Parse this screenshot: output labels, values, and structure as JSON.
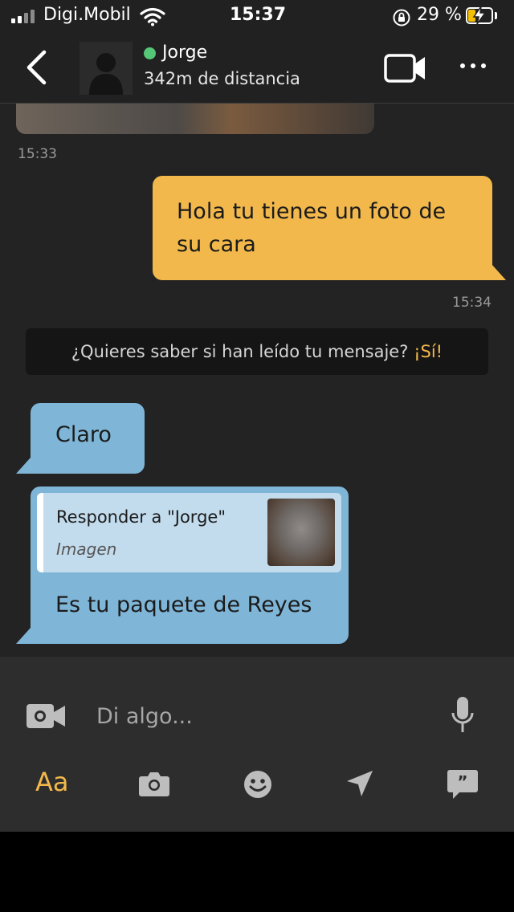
{
  "status_bar": {
    "carrier": "Digi.Mobil",
    "time": "15:37",
    "battery": "29 %",
    "colors": {
      "battery_fill": "#f5c000"
    }
  },
  "header": {
    "contact_name": "Jorge",
    "distance": "342m de distancia",
    "online_color": "#55c877",
    "icons": [
      "back-icon",
      "avatar-placeholder",
      "video-call-icon",
      "more-icon"
    ]
  },
  "chat": {
    "messages": [
      {
        "type": "image",
        "direction": "incoming",
        "timestamp": "15:33"
      },
      {
        "type": "text",
        "direction": "outgoing",
        "text": "Hola tu tienes un foto de su cara",
        "timestamp": "15:34"
      },
      {
        "type": "text",
        "direction": "incoming",
        "text": "Claro"
      },
      {
        "type": "reply",
        "direction": "incoming",
        "reply_title": "Responder a \"Jorge\"",
        "reply_subtitle": "Imagen",
        "text": "Es tu paquete de Reyes"
      }
    ],
    "read_receipt": {
      "prompt": "¿Quieres saber si han leído tu mensaje?",
      "action": "¡Sí!"
    },
    "colors": {
      "outgoing": "#f2b84b",
      "incoming": "#7fb6d8",
      "accent": "#f2b84b"
    }
  },
  "composer": {
    "placeholder": "Di algo...",
    "toolbar": [
      {
        "name": "text-format",
        "label": "Aa"
      },
      {
        "name": "camera-icon"
      },
      {
        "name": "emoji-icon"
      },
      {
        "name": "location-icon"
      },
      {
        "name": "quote-icon"
      }
    ]
  }
}
